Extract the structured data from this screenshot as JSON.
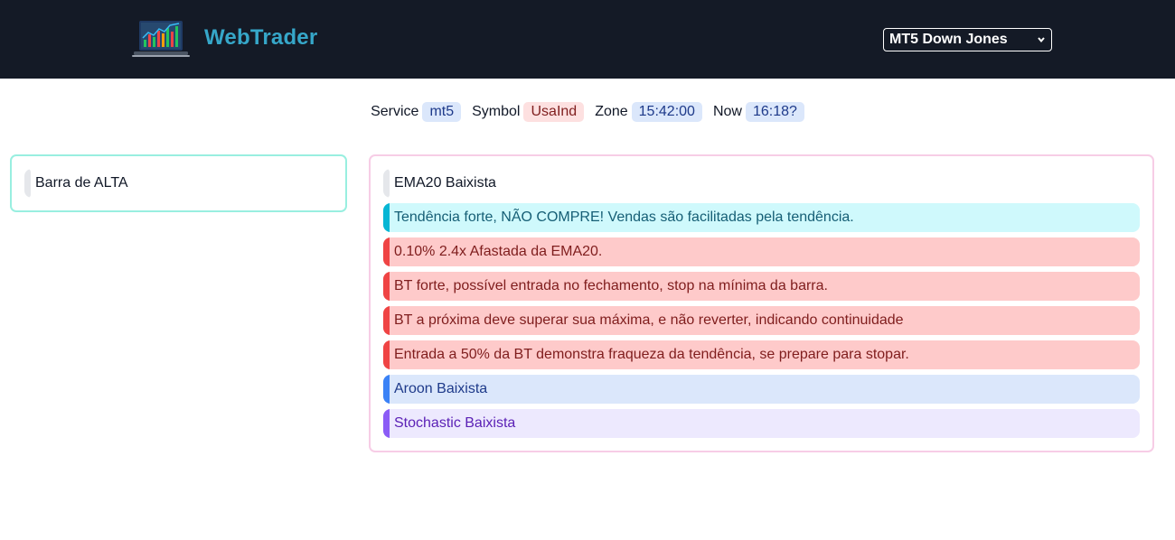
{
  "header": {
    "brand": "WebTrader",
    "account_select": "MT5 Down Jones"
  },
  "status": {
    "service_label": "Service",
    "service_value": "mt5",
    "symbol_label": "Symbol",
    "symbol_value": "UsaInd",
    "zone_label": "Zone",
    "zone_value": "15:42:00",
    "now_label": "Now",
    "now_value": "16:18?"
  },
  "left_panel": {
    "items": [
      {
        "text": "Barra de ALTA",
        "style": "plain"
      }
    ]
  },
  "right_panel": {
    "items": [
      {
        "text": "EMA20 Baixista",
        "style": "plain"
      },
      {
        "text": "Tendência forte, NÃO COMPRE! Vendas são facilitadas pela tendência.",
        "style": "cyan"
      },
      {
        "text": "0.10% 2.4x Afastada da EMA20.",
        "style": "red"
      },
      {
        "text": "BT forte, possível entrada no fechamento, stop na mínima da barra.",
        "style": "red"
      },
      {
        "text": "BT a próxima deve superar sua máxima, e não reverter, indicando continuidade",
        "style": "red"
      },
      {
        "text": "Entrada a 50% da BT demonstra fraqueza da tendência, se prepare para stopar.",
        "style": "red"
      },
      {
        "text": "Aroon Baixista",
        "style": "blue"
      },
      {
        "text": "Stochastic Baixista",
        "style": "purple"
      }
    ]
  },
  "colors": {
    "header_bg": "#141a26",
    "brand": "#36a7c9",
    "left_panel_border": "#99efe0",
    "right_panel_border": "#f7cde6"
  }
}
